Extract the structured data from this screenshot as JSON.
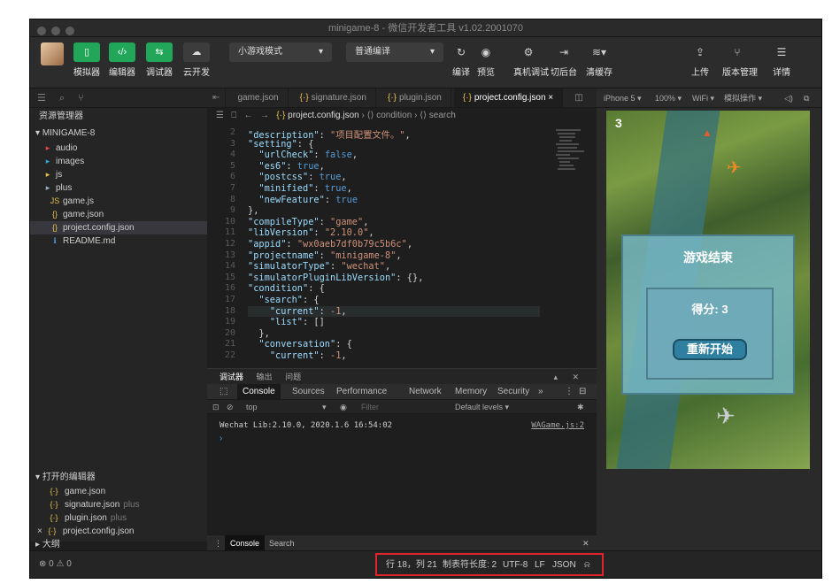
{
  "window": {
    "title": "minigame-8 - 微信开发者工具 v1.02.2001070"
  },
  "toolbar": {
    "simulator": "模拟器",
    "editor": "编辑器",
    "debugger": "调试器",
    "cloud": "云开发",
    "mode": "小游戏模式",
    "compile_mode": "普通编译",
    "compile": "编译",
    "preview": "预览",
    "realdevice": "真机调试",
    "background": "切后台",
    "clearcache": "清缓存",
    "upload": "上传",
    "version": "版本管理",
    "details": "详情"
  },
  "sidebar": {
    "explorer_title": "资源管理器",
    "project_title": "MINIGAME-8",
    "tree": [
      {
        "label": "audio",
        "icon": "▸",
        "color": "#e0474c"
      },
      {
        "label": "images",
        "icon": "▸",
        "color": "#2fa4d9"
      },
      {
        "label": "js",
        "icon": "▸",
        "color": "#e8c14b"
      },
      {
        "label": "plus",
        "icon": "▸",
        "color": "#9ab0c8"
      },
      {
        "label": "game.js",
        "icon": "JS",
        "color": "#e8c14b"
      },
      {
        "label": "game.json",
        "icon": "{}",
        "color": "#e8c14b"
      },
      {
        "label": "project.config.json",
        "icon": "{}",
        "color": "#e8c14b"
      },
      {
        "label": "README.md",
        "icon": "ℹ",
        "color": "#4a9cdf"
      }
    ],
    "open_editors_title": "打开的编辑器",
    "open_editors": [
      {
        "label": "game.json",
        "extra": ""
      },
      {
        "label": "signature.json",
        "extra": "plus"
      },
      {
        "label": "plugin.json",
        "extra": "plus"
      },
      {
        "label": "project.config.json",
        "extra": ""
      }
    ],
    "outline_title": "大纲"
  },
  "tabs": [
    {
      "label": "game.json"
    },
    {
      "label": "signature.json"
    },
    {
      "label": "plugin.json"
    },
    {
      "label": "project.config.json"
    }
  ],
  "breadcrumb": {
    "file": "project.config.json",
    "sep": "›",
    "path1": "condition",
    "path2": "search"
  },
  "code": {
    "line_numbers": [
      "2",
      "3",
      "4",
      "5",
      "6",
      "7",
      "8",
      "9",
      "10",
      "11",
      "12",
      "13",
      "14",
      "15",
      "16",
      "17",
      "18",
      "19",
      "20",
      "21",
      "22"
    ],
    "lines": [
      "\"description\": \"项目配置文件。\",",
      "\"setting\": {",
      "  \"urlCheck\": false,",
      "  \"es6\": true,",
      "  \"postcss\": true,",
      "  \"minified\": true,",
      "  \"newFeature\": true",
      "},",
      "\"compileType\": \"game\",",
      "\"libVersion\": \"2.10.0\",",
      "\"appid\": \"wx0aeb7df0b79c5b6c\",",
      "\"projectname\": \"minigame-8\",",
      "\"simulatorType\": \"wechat\",",
      "\"simulatorPluginLibVersion\": {},",
      "\"condition\": {",
      "  \"search\": {",
      "    \"current\": -1,",
      "    \"list\": []",
      "  },",
      "  \"conversation\": {",
      "    \"current\": -1,"
    ]
  },
  "devtools": {
    "tabs": [
      "调试器",
      "输出",
      "问题"
    ],
    "panels": [
      "Console",
      "Sources",
      "Performance",
      "Network",
      "Memory",
      "Security",
      "»"
    ],
    "context": "top",
    "filter_placeholder": "Filter",
    "levels": "Default levels ▾",
    "log_text": "Wechat Lib:2.10.0, 2020.1.6 16:54:02",
    "log_source": "WAGame.js:2",
    "prompt": "›",
    "drawer_console": "Console",
    "drawer_search": "Search"
  },
  "simulator": {
    "device": "iPhone 5 ▾",
    "zoom": "100% ▾",
    "network": "WiFi ▾",
    "ops": "模拟操作 ▾",
    "score_top": "3",
    "game_over": "游戏结束",
    "score_text": "得分: 3",
    "restart": "重新开始"
  },
  "statusbar": {
    "errors": "⊗ 0 ⚠ 0",
    "position": "行 18，列 21",
    "tabsize": "制表符长度: 2",
    "encoding": "UTF-8",
    "eol": "LF",
    "language": "JSON",
    "bell": "🔔"
  }
}
